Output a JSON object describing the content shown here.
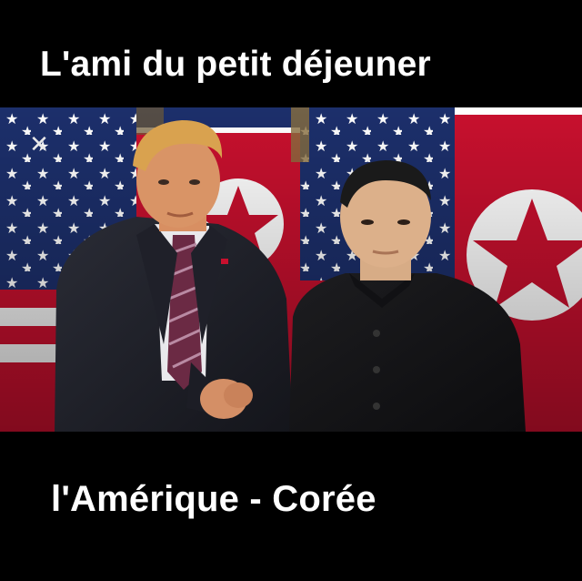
{
  "meme": {
    "top_caption": "L'ami du petit déjeuner",
    "bottom_caption": "l'Amérique - Corée",
    "close_glyph": "✕",
    "colors": {
      "background": "#000000",
      "caption_text": "#ffffff",
      "flag_red": "#c8102e",
      "flag_blue": "#1c2f6b",
      "flag_white": "#ffffff"
    }
  }
}
